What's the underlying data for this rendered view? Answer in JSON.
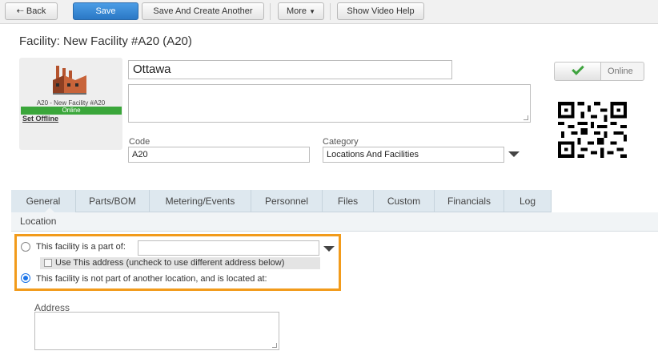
{
  "toolbar": {
    "back_label": "Back",
    "save_label": "Save",
    "save_and_create_label": "Save And Create Another",
    "more_label": "More",
    "show_video_help_label": "Show Video Help"
  },
  "page": {
    "title": "Facility: New Facility #A20 (A20)"
  },
  "facility": {
    "image_caption": "A20 - New Facility #A20",
    "status_bar": "Online",
    "set_offline_label": "Set Offline",
    "name_value": "Ottawa",
    "description_value": "",
    "code_label": "Code",
    "code_value": "A20",
    "category_label": "Category",
    "category_value": "Locations And Facilities",
    "online_toggle_label": "Online"
  },
  "tabs": [
    {
      "label": "General",
      "active": true
    },
    {
      "label": "Parts/BOM"
    },
    {
      "label": "Metering/Events"
    },
    {
      "label": "Personnel"
    },
    {
      "label": "Files"
    },
    {
      "label": "Custom"
    },
    {
      "label": "Financials"
    },
    {
      "label": "Log"
    }
  ],
  "location": {
    "section_label": "Location",
    "part_of_label": "This facility is a part of:",
    "part_of_value": "",
    "use_address_label": "Use This address (uncheck to use different address below)",
    "not_part_label": "This facility is not part of another location, and is located at:",
    "selected_option": "not_part",
    "address_label": "Address",
    "address_value": ""
  },
  "colors": {
    "primary_button": "#2b78c5",
    "online_green": "#3aa63a",
    "highlight_orange": "#f29b1b",
    "tab_strip": "#dee8ef"
  }
}
